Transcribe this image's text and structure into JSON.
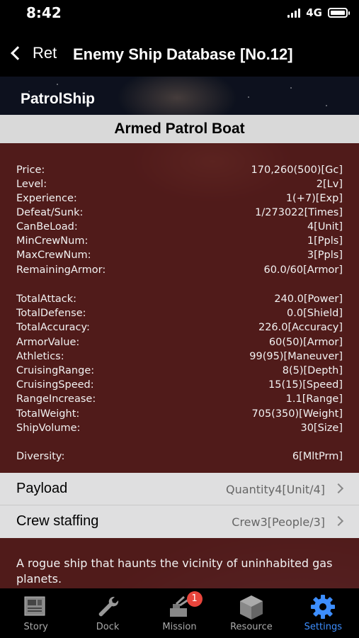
{
  "status_bar": {
    "time": "8:42",
    "network": "4G",
    "battery_level": 1.0
  },
  "nav": {
    "back_label": "Ret",
    "title": "Enemy Ship Database [No.12]"
  },
  "category": "PatrolShip",
  "ship_name": "Armed Patrol Boat",
  "stats": [
    {
      "label": "Price:",
      "value": "170,260(500)[Gc]"
    },
    {
      "label": "Level:",
      "value": "2[Lv]"
    },
    {
      "label": "Experience:",
      "value": "1(+7)[Exp]"
    },
    {
      "label": "Defeat/Sunk:",
      "value": "1/273022[Times]"
    },
    {
      "label": "CanBeLoad:",
      "value": "4[Unit]"
    },
    {
      "label": "MinCrewNum:",
      "value": "1[Ppls]"
    },
    {
      "label": "MaxCrewNum:",
      "value": "3[Ppls]"
    },
    {
      "label": "RemainingArmor:",
      "value": "60.0/60[Armor]"
    },
    {
      "label": "TotalAttack:",
      "value": "240.0[Power]"
    },
    {
      "label": "TotalDefense:",
      "value": "0.0[Shield]"
    },
    {
      "label": "TotalAccuracy:",
      "value": "226.0[Accuracy]"
    },
    {
      "label": "ArmorValue:",
      "value": "60(50)[Armor]"
    },
    {
      "label": "Athletics:",
      "value": "99(95)[Maneuver]"
    },
    {
      "label": "CruisingRange:",
      "value": "8(5)[Depth]"
    },
    {
      "label": "CruisingSpeed:",
      "value": "15(15)[Speed]"
    },
    {
      "label": "RangeIncrease:",
      "value": "1.1[Range]"
    },
    {
      "label": "TotalWeight:",
      "value": "705(350)[Weight]"
    },
    {
      "label": "ShipVolume:",
      "value": "30[Size]"
    },
    {
      "label": "Diversity:",
      "value": "6[MltPrm]"
    }
  ],
  "payload": {
    "label": "Payload",
    "value": "Quantity4[Unit/4]"
  },
  "crew": {
    "label": "Crew staffing",
    "value": "Crew3[People/3]"
  },
  "description": "A rogue ship that haunts the vicinity of uninhabited gas planets.",
  "tabs": [
    {
      "label": "Story",
      "icon": "story-icon"
    },
    {
      "label": "Dock",
      "icon": "wrench-icon"
    },
    {
      "label": "Mission",
      "icon": "mission-icon",
      "badge": "1"
    },
    {
      "label": "Resource",
      "icon": "box-icon"
    },
    {
      "label": "Settings",
      "icon": "gear-icon",
      "active": true
    }
  ],
  "colors": {
    "active_tab": "#3d8eff",
    "badge": "#e8453c",
    "stats_panel": "#601e1c"
  }
}
